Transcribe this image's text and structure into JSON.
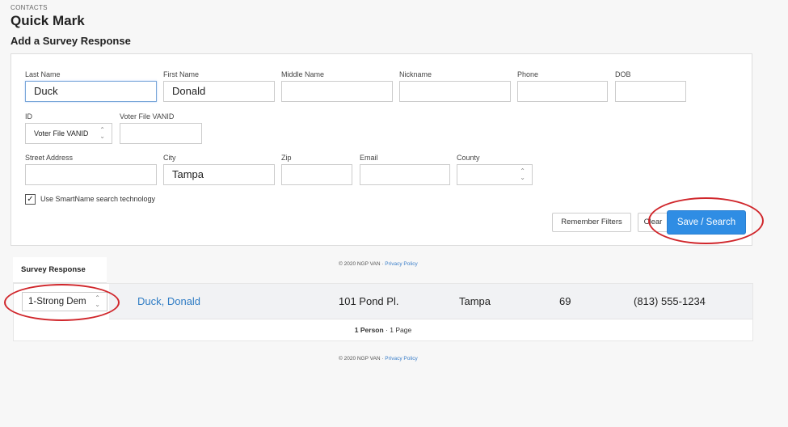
{
  "breadcrumb": "CONTACTS",
  "title": "Quick Mark",
  "subtitle": "Add a Survey Response",
  "form": {
    "last_name": {
      "label": "Last Name",
      "value": "Duck"
    },
    "first_name": {
      "label": "First Name",
      "value": "Donald"
    },
    "middle_name": {
      "label": "Middle Name",
      "value": ""
    },
    "nickname": {
      "label": "Nickname",
      "value": ""
    },
    "phone": {
      "label": "Phone",
      "value": ""
    },
    "dob": {
      "label": "DOB",
      "value": ""
    },
    "id": {
      "label": "ID",
      "value": "Voter File VANID"
    },
    "vanid": {
      "label": "Voter File VANID",
      "value": ""
    },
    "street": {
      "label": "Street Address",
      "value": ""
    },
    "city": {
      "label": "City",
      "value": "Tampa"
    },
    "zip": {
      "label": "Zip",
      "value": ""
    },
    "email": {
      "label": "Email",
      "value": ""
    },
    "county": {
      "label": "County",
      "value": ""
    },
    "smartname": {
      "label": "Use SmartName search technology",
      "checked": true,
      "check_glyph": "✓"
    }
  },
  "buttons": {
    "remember": "Remember Filters",
    "clear": "Clear",
    "save": "Save / Search"
  },
  "footer": {
    "copyright": "© 2020 NGP VAN · ",
    "privacy": "Privacy Policy"
  },
  "results": {
    "survey_header": "Survey Response",
    "rows": [
      {
        "survey_value": "1-Strong Dem",
        "name": "Duck, Donald",
        "address": "101 Pond Pl.",
        "city": "Tampa",
        "age": "69",
        "phone": "(813) 555-1234"
      }
    ],
    "pager_count": "1 Person",
    "pager_sep": " · ",
    "pager_pages": "1 Page"
  },
  "icons": {
    "chevron": "⌃⌄"
  },
  "colors": {
    "primary": "#2f8de4",
    "annotation": "#d0262b",
    "link": "#2f7cc4"
  }
}
